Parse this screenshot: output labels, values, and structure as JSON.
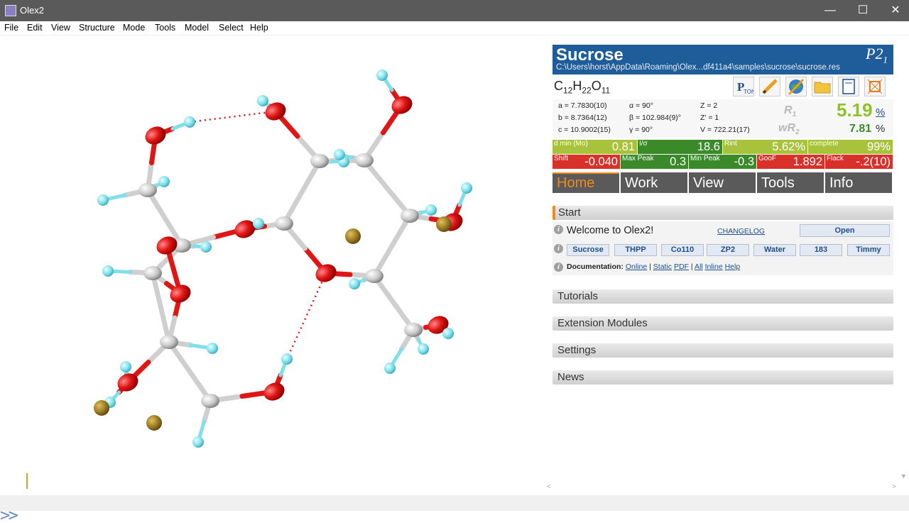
{
  "window": {
    "title": "Olex2",
    "minimize": "—",
    "maximize": "☐",
    "close": "✕"
  },
  "menu": [
    "File",
    "Edit",
    "View",
    "Structure",
    "Mode",
    "Tools",
    "Model",
    "Select",
    "Help"
  ],
  "command_line": {
    "prompt": ">>"
  },
  "structure": {
    "name": "Sucrose",
    "space_group": "P21",
    "path": "C:\\Users\\horst\\AppData\\Roaming\\Olex...df411a4\\samples\\sucrose\\sucrose.res",
    "formula": {
      "c": "C",
      "c_n": "12",
      "h": "H",
      "h_n": "22",
      "o": "O",
      "o_n": "11"
    }
  },
  "toolbar_icons": [
    "ptable-icon",
    "pencil-icon",
    "globe-icon",
    "folder-icon",
    "notepad-icon",
    "crystal-icon"
  ],
  "cell": {
    "a": "a = 7.7830(10)",
    "b": "b = 8.7364(12)",
    "c": "c = 10.9002(15)",
    "alpha": "α = 90°",
    "beta": "β = 102.984(9)°",
    "gamma": "γ = 90°",
    "Z": "Z = 2",
    "Zp": "Z' = 1",
    "V": "V = 722.21(17)"
  },
  "refinement": {
    "r1_label": "R",
    "r1_sub": "1",
    "r1_value": "5.19",
    "r1_unit": "%",
    "wr2_label": "wR",
    "wr2_sub": "2",
    "wr2_value": "7.81",
    "wr2_unit": "%",
    "green_color": "#8fc02e"
  },
  "stats_row1": [
    {
      "label": "d min (Mo)",
      "value": "0.81",
      "color": "#a9c23b"
    },
    {
      "label": "I/σ",
      "value": "18.6",
      "color": "#3a8a2a"
    },
    {
      "label": "Rint",
      "value": "5.62%",
      "color": "#a9c23b"
    },
    {
      "label": "complete",
      "value": "99%",
      "color": "#a9c23b"
    }
  ],
  "stats_row2": [
    {
      "label": "Shift",
      "value": "-0.040",
      "color": "#d9302a"
    },
    {
      "label": "Max Peak",
      "value": "0.3",
      "color": "#3a8a2a"
    },
    {
      "label": "Min Peak",
      "value": "-0.3",
      "color": "#3a8a2a"
    },
    {
      "label": "GooF",
      "value": "1.892",
      "color": "#d9302a"
    },
    {
      "label": "Flack",
      "value": "-.2(10)",
      "color": "#d9302a"
    }
  ],
  "tabs": [
    {
      "label": "Home",
      "active": true
    },
    {
      "label": "Work",
      "active": false
    },
    {
      "label": "View",
      "active": false
    },
    {
      "label": "Tools",
      "active": false
    },
    {
      "label": "Info",
      "active": false
    }
  ],
  "start": {
    "title": "Start",
    "welcome": "Welcome to Olex2!",
    "changelog": "CHANGELOG",
    "open": "Open",
    "samples": [
      "Sucrose",
      "THPP",
      "Co110",
      "ZP2",
      "Water",
      "183",
      "Timmy"
    ],
    "doc_label": "Documentation:",
    "doc_online": "Online",
    "doc_sep1": "|",
    "doc_static": "Static",
    "doc_pdf": "PDF",
    "doc_sep2": "|",
    "doc_all": "All",
    "doc_inline": "Inline",
    "doc_help": "Help"
  },
  "sections": [
    "Tutorials",
    "Extension Modules",
    "Settings",
    "News"
  ],
  "atom_colors": {
    "carbon": "#c8c8c8",
    "oxygen": "#e01515",
    "hydrogen": "#7fe0ec",
    "peak": "#9a7a20",
    "bond": "#cfcfcf"
  }
}
